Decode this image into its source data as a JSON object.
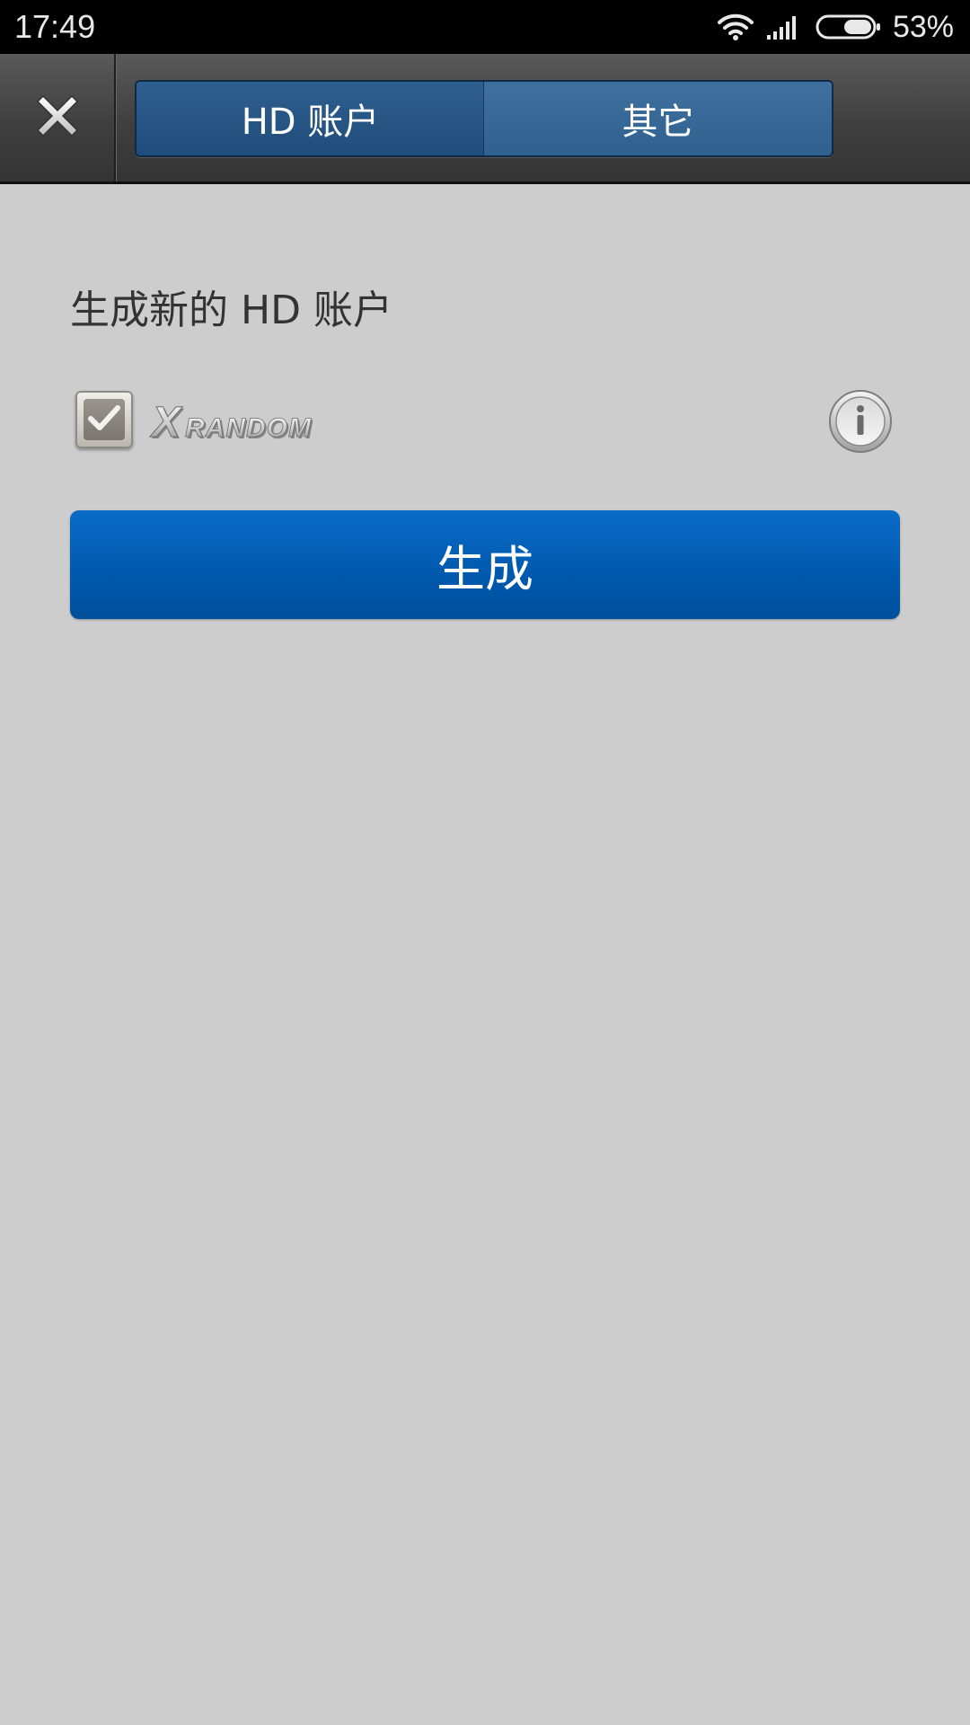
{
  "status_bar": {
    "time": "17:49",
    "battery_percent": "53%",
    "battery_level": 0.53
  },
  "toolbar": {
    "close_icon": "close-icon",
    "tabs": [
      {
        "label": "HD 账户",
        "active": true
      },
      {
        "label": "其它",
        "active": false
      }
    ]
  },
  "content": {
    "section_title": "生成新的 HD 账户",
    "xrandom_checked": true,
    "xrandom_logo_text": "XRANDOM",
    "info_icon": "info-icon",
    "generate_label": "生成"
  },
  "colors": {
    "background": "#cdcdcd",
    "primary_button": "#005ab0",
    "tab_active": "#1f4d7b",
    "tab_inactive": "#2f618f",
    "title_text": "#333333"
  }
}
